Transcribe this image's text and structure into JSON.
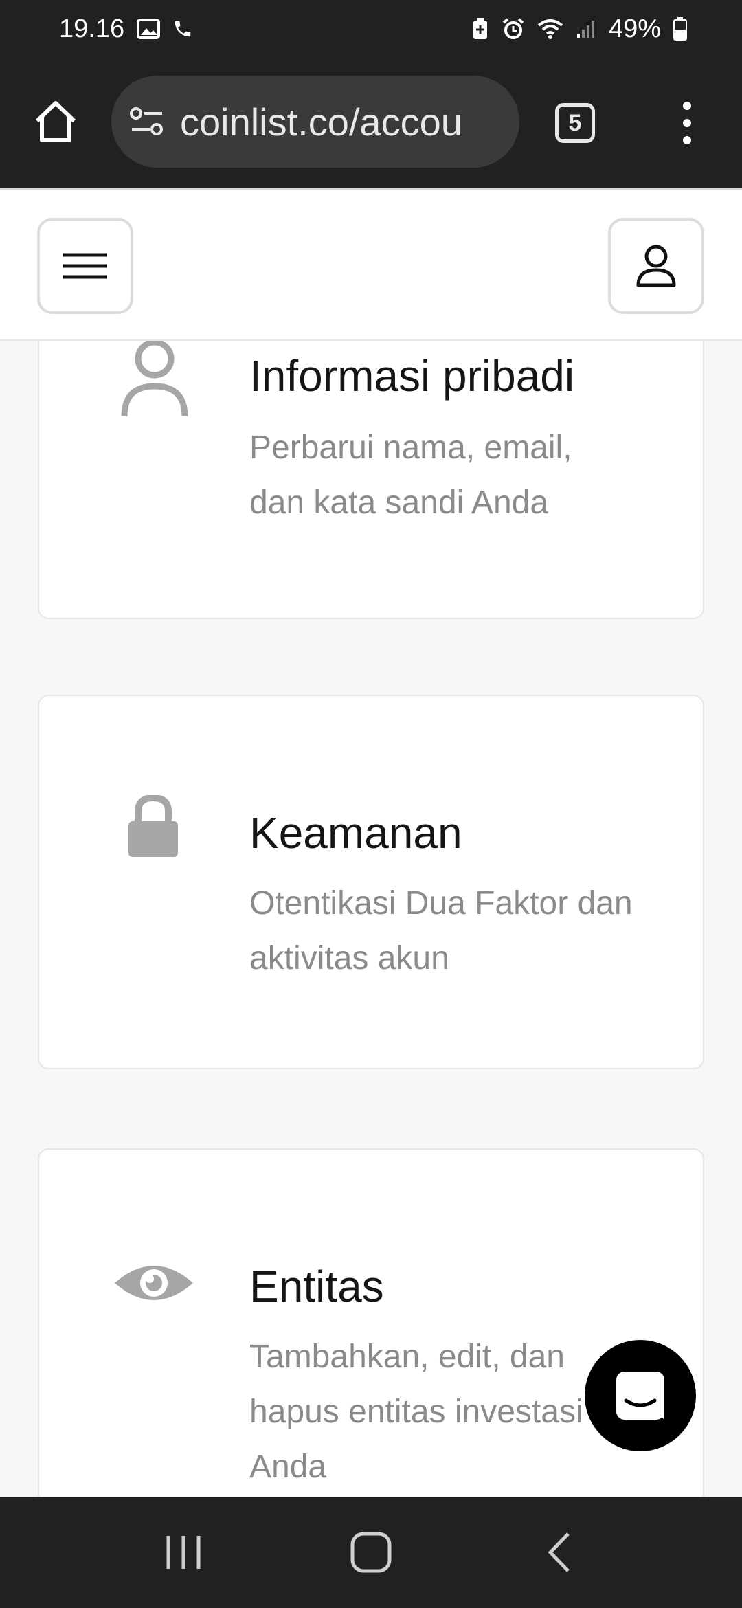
{
  "status_bar": {
    "time": "19.16",
    "battery": "49%"
  },
  "browser": {
    "url": "coinlist.co/accou",
    "tab_count": "5"
  },
  "cards": [
    {
      "title": "Informasi pribadi",
      "description": "Perbarui nama, email, dan kata sandi Anda",
      "icon": "person-icon"
    },
    {
      "title": "Keamanan",
      "description": "Otentikasi Dua Faktor dan aktivitas akun",
      "icon": "lock-icon"
    },
    {
      "title": "Entitas",
      "description": "Tambahkan, edit, dan hapus entitas investasi Anda",
      "icon": "eye-icon"
    }
  ],
  "colors": {
    "system_bar": "#212121",
    "url_pill": "#3a3a3a",
    "page_bg": "#f7f7f7",
    "icon_gray": "#a6a6a6",
    "title": "#151515",
    "desc": "#8a8a8a"
  }
}
